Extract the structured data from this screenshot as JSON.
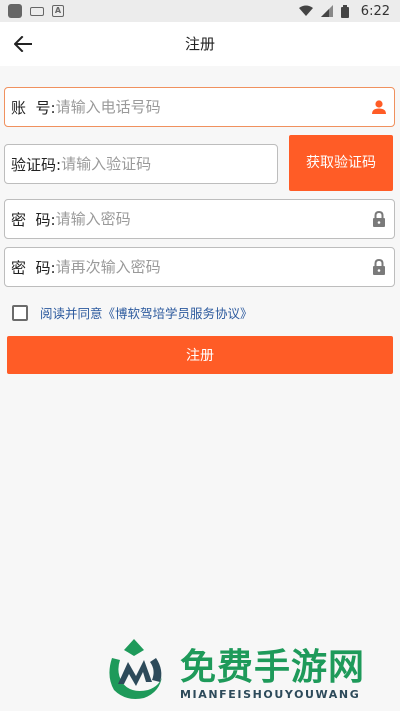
{
  "status_bar": {
    "time": "6:22"
  },
  "header": {
    "title": "注册",
    "back_icon": "arrow-left-icon"
  },
  "form": {
    "account": {
      "label": "账  号:",
      "placeholder": "请输入电话号码",
      "icon": "person-icon"
    },
    "code": {
      "label": "验证码:",
      "placeholder": "请输入验证码"
    },
    "get_code_button": "获取验证码",
    "password": {
      "label": "密  码:",
      "placeholder": "请输入密码",
      "icon": "lock-icon"
    },
    "confirm_password": {
      "label": "密  码:",
      "placeholder": "请再次输入密码",
      "icon": "lock-icon"
    },
    "agreement": {
      "checked": false,
      "text": "阅读并同意《博软驾培学员服务协议》"
    },
    "register_button": "注册"
  },
  "watermark": {
    "title": "免费手游网",
    "subtitle": "MIANFEISHOUYOUWANG"
  },
  "colors": {
    "accent": "#ff5c26",
    "link": "#2c5a9e",
    "watermark": "#1e9a5a"
  }
}
